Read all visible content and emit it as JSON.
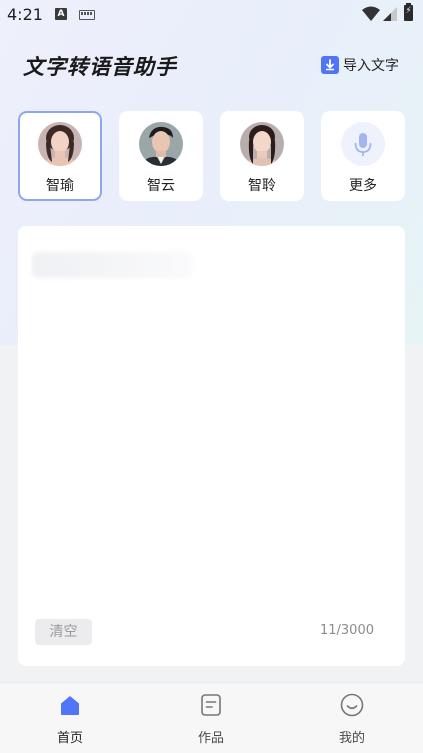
{
  "status_bar": {
    "time": "4:21",
    "icons": [
      "text-a-icon",
      "keyboard-icon",
      "wifi-icon",
      "cell-signal-icon",
      "battery-charging-icon"
    ]
  },
  "header": {
    "title": "文字转语音助手",
    "import_label": "导入文字",
    "import_icon": "download-file-icon"
  },
  "voices": [
    {
      "name": "智瑜",
      "selected": true,
      "avatar": "avatar-female-icon"
    },
    {
      "name": "智云",
      "selected": false,
      "avatar": "avatar-male-icon"
    },
    {
      "name": "智聆",
      "selected": false,
      "avatar": "avatar-female-icon"
    },
    {
      "name": "更多",
      "selected": false,
      "avatar": "microphone-icon"
    }
  ],
  "editor": {
    "text": "",
    "clear_label": "清空",
    "char_count": "11/3000"
  },
  "bottom_nav": [
    {
      "label": "首页",
      "icon": "home-icon",
      "active": true
    },
    {
      "label": "作品",
      "icon": "document-icon",
      "active": false
    },
    {
      "label": "我的",
      "icon": "smile-icon",
      "active": false
    }
  ],
  "colors": {
    "accent": "#4f76f6",
    "selected_border": "#8ea6f0",
    "gradient_start": "#eef0fb",
    "gradient_end": "#e6f4f6"
  }
}
